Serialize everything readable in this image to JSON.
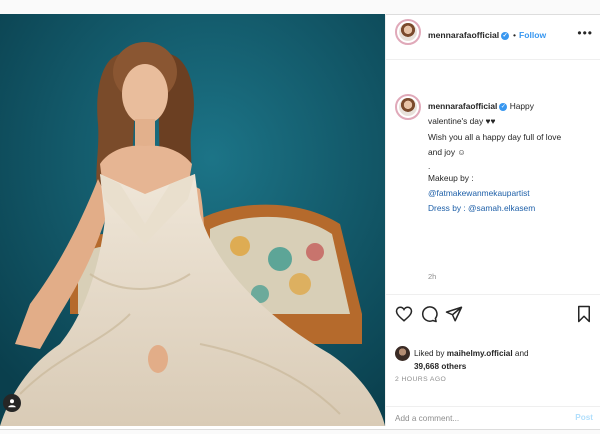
{
  "post": {
    "username": "mennarafaofficial",
    "verified_icon": "✓",
    "separator": "•",
    "follow_label": "Follow",
    "more_icon": "•••",
    "caption": {
      "username": "mennarafaofficial",
      "lines": [
        "Happy",
        "valentine's day ♥♥",
        "Wish you all a happy day full of love",
        "and joy ☺",
        ".",
        "Makeup by :",
        "@fatmakewanmekaupartist",
        "Dress by : @samah.elkasem"
      ],
      "time_ago": "2h"
    },
    "likes": {
      "prefix": "Liked by",
      "user": "maihelmy.official",
      "connector": "and",
      "others": "39,668 others"
    },
    "date": "2 HOURS AGO",
    "comment": {
      "placeholder": "Add a comment...",
      "post_label": "Post"
    }
  },
  "icons": {
    "like": "heart-icon",
    "comment": "comment-icon",
    "share": "share-icon",
    "save": "bookmark-icon",
    "user_tag": "user-icon"
  },
  "colors": {
    "background_teal": "#0f5a6b",
    "link_blue": "#3897f0",
    "mention": "#1d5fa8",
    "muted": "#8e8e8e"
  }
}
